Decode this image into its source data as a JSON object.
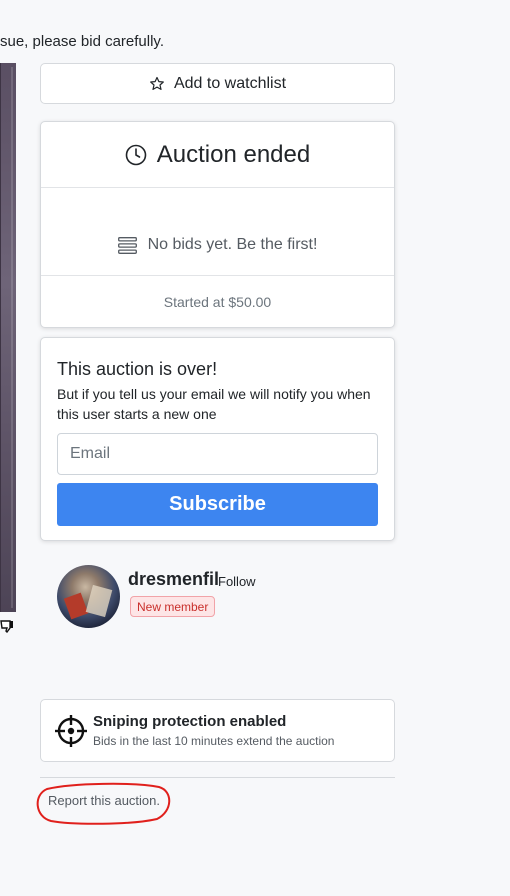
{
  "notice": {
    "text": "sue, please bid carefully."
  },
  "watchlist": {
    "label": "Add to watchlist",
    "icon": "star-icon"
  },
  "auction": {
    "status": "Auction ended",
    "no_bids": "No bids yet. Be the first!",
    "started_at": "Started at $50.00"
  },
  "subscribe_card": {
    "title": "This auction is over!",
    "description": "But if you tell us your email we will notify you when this user starts a new one",
    "email_placeholder": "Email",
    "button_label": "Subscribe",
    "button_color": "#3d85f0"
  },
  "seller": {
    "username": "dresmenfil",
    "follow_label": "Follow",
    "badge": "New member"
  },
  "sniping": {
    "title": "Sniping protection enabled",
    "description": "Bids in the last 10 minutes extend the auction"
  },
  "report": {
    "label": "Report this auction."
  },
  "annotation": {
    "color": "#e0201c"
  }
}
